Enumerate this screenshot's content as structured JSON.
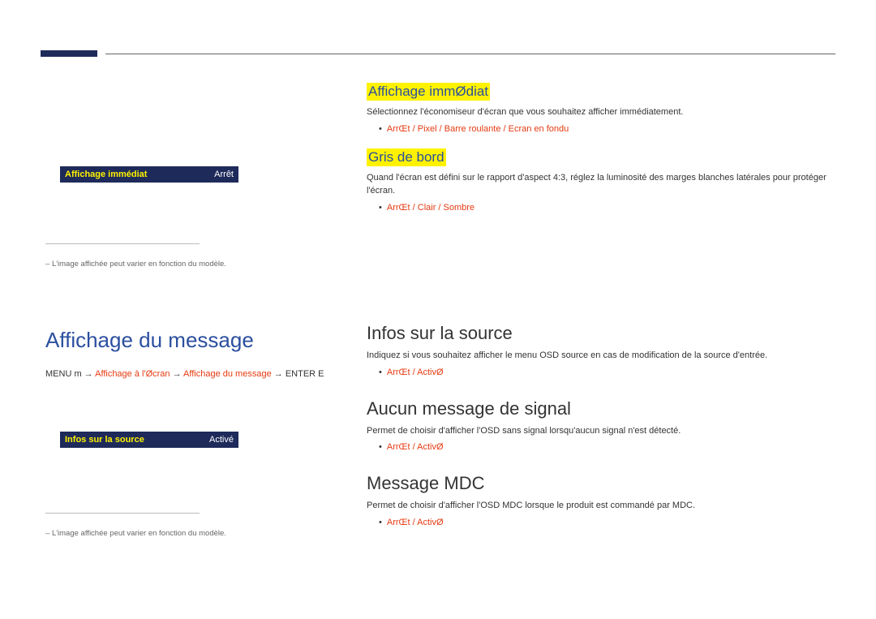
{
  "topRight": {
    "affichageImmediat": {
      "title": "Affichage immØdiat",
      "desc": "Sélectionnez l'économiseur d'écran que vous souhaitez afficher immédiatement.",
      "options": "ArrŒt / Pixel / Barre roulante / Ecran en fondu"
    },
    "grisDeBord": {
      "title": "Gris de bord",
      "desc": "Quand l'écran est défini sur le rapport d'aspect 4:3, réglez la luminosité des marges blanches latérales pour protéger l'écran.",
      "options": "ArrŒt / Clair / Sombre"
    }
  },
  "leftMenu1": {
    "label": "Affichage immédiat",
    "value": "Arrêt"
  },
  "note1": "L'image affichée peut varier en fonction du modèle.",
  "affichageMessage": {
    "title": "Affichage du message",
    "breadcrumb": {
      "menu": "MENU m",
      "sep1": " → ",
      "p1": "Affichage à l'Øcran",
      "sep2": " → ",
      "p2": "Affichage du message",
      "sep3": " → ",
      "enter": "ENTER E"
    }
  },
  "leftMenu2": {
    "label": "Infos sur la source",
    "value": "Activé"
  },
  "note2": "L'image affichée peut varier en fonction du modèle.",
  "rightLower": {
    "infosSource": {
      "title": "Infos sur la source",
      "desc": "Indiquez si vous souhaitez afficher le menu OSD source en cas de modification de la source d'entrée.",
      "options": "ArrŒt / ActivØ"
    },
    "aucunMessage": {
      "title": "Aucun message de signal",
      "desc": "Permet de choisir d'afficher l'OSD sans signal lorsqu'aucun signal n'est détecté.",
      "options": "ArrŒt / ActivØ"
    },
    "messageMDC": {
      "title": "Message MDC",
      "desc": "Permet de choisir d'afficher l'OSD MDC lorsque le produit est commandé par MDC.",
      "options": "ArrŒt / ActivØ"
    }
  }
}
